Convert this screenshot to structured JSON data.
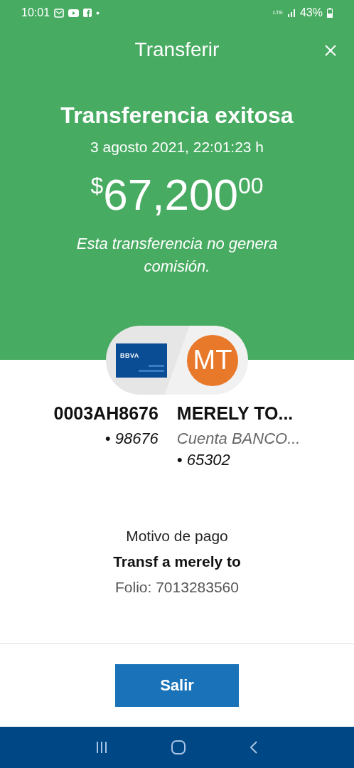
{
  "status_bar": {
    "time": "10:01",
    "network": "LTE",
    "battery": "43%"
  },
  "header": {
    "title": "Transferir"
  },
  "result": {
    "heading": "Transferencia exitosa",
    "date": "3 agosto 2021, 22:01:23 h",
    "amount": {
      "currency": "$",
      "integer": "67,200",
      "cents": "00"
    },
    "note": "Esta transferencia no genera comisión."
  },
  "origin": {
    "logo": "BBVA",
    "name": "0003AH8676",
    "account": "• 98676"
  },
  "destination": {
    "initials": "MT",
    "name": "MERELY TO...",
    "bank": "Cuenta BANCO...",
    "account": "• 65302"
  },
  "details": {
    "label": "Motivo de pago",
    "reason": "Transf a merely to",
    "folio": "Folio: 7013283560"
  },
  "buttons": [
    {
      "label": "Salir"
    }
  ]
}
